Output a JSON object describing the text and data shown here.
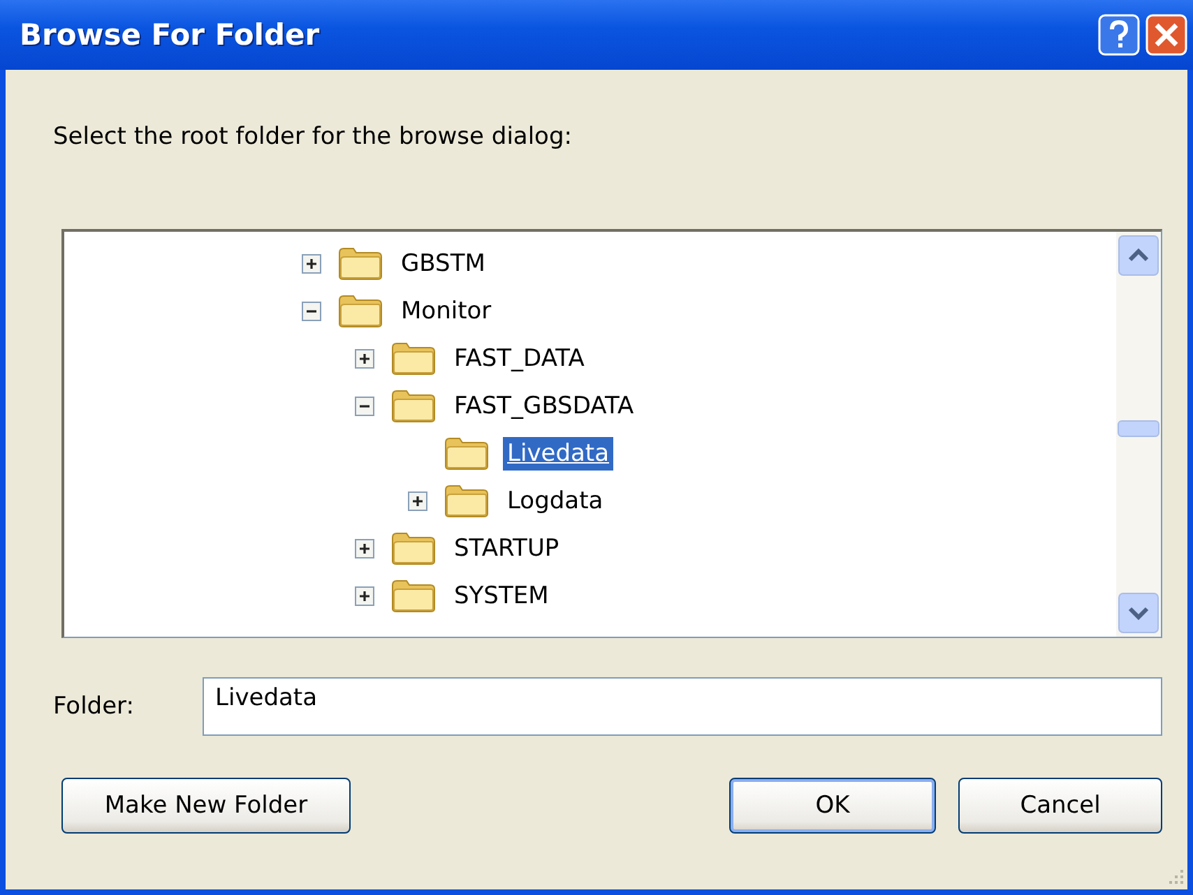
{
  "window": {
    "title": "Browse For Folder"
  },
  "instruction": "Select the root folder for the browse dialog:",
  "tree": [
    {
      "label": "GBSTM",
      "expanded": false,
      "selected": false
    },
    {
      "label": "Monitor",
      "expanded": true,
      "selected": false,
      "children": [
        {
          "label": "FAST_DATA",
          "expanded": false,
          "selected": false
        },
        {
          "label": "FAST_GBSDATA",
          "expanded": true,
          "selected": false,
          "children": [
            {
              "label": "Livedata",
              "selected": true
            },
            {
              "label": "Logdata",
              "expanded": false,
              "selected": false
            }
          ]
        },
        {
          "label": "STARTUP",
          "expanded": false,
          "selected": false
        },
        {
          "label": "SYSTEM",
          "expanded": false,
          "selected": false
        }
      ]
    }
  ],
  "folder_field": {
    "label": "Folder:",
    "value": "Livedata"
  },
  "buttons": [
    {
      "label": "Make New Folder",
      "kind": "secondary"
    },
    {
      "label": "OK",
      "kind": "default"
    },
    {
      "label": "Cancel",
      "kind": "secondary"
    }
  ]
}
